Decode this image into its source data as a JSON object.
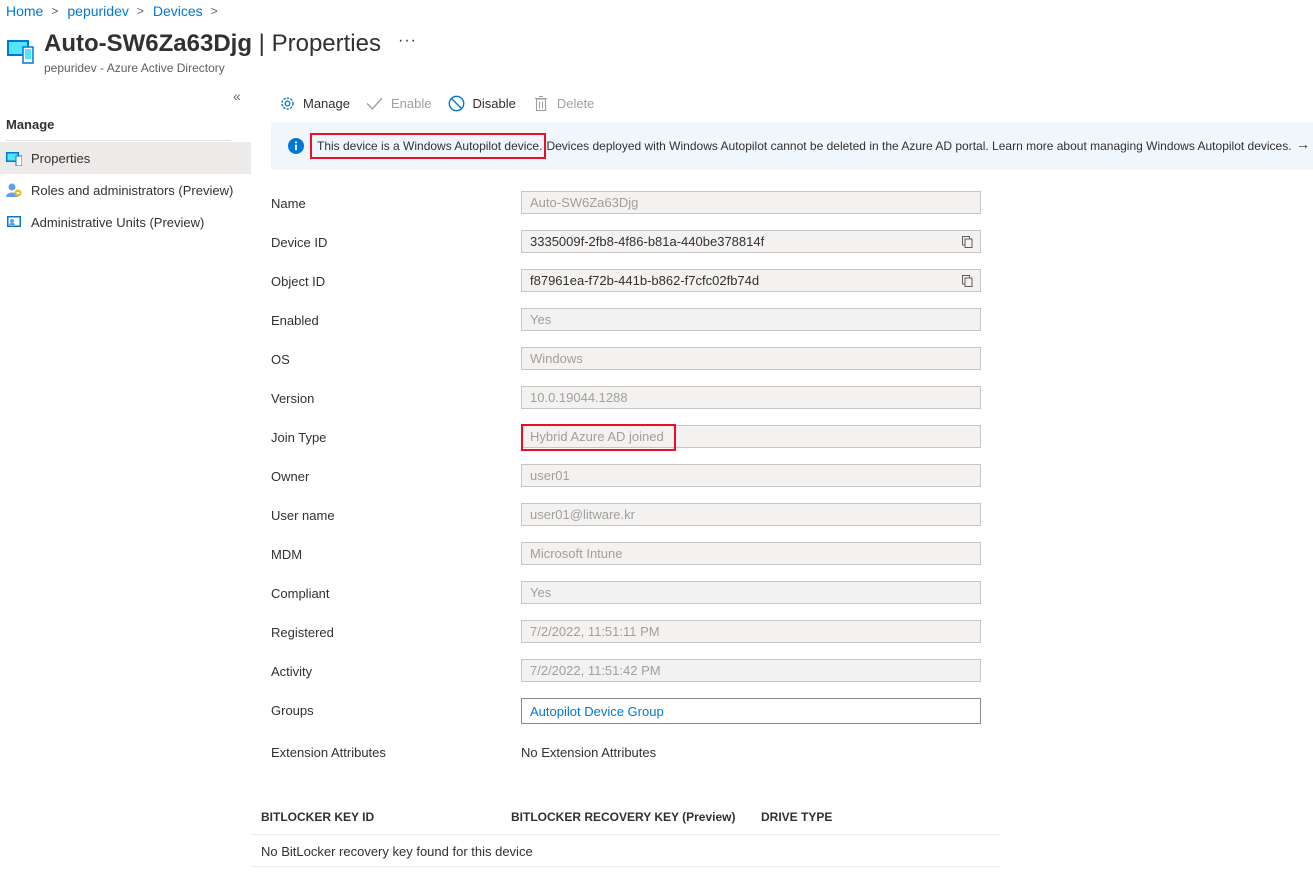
{
  "breadcrumb": [
    {
      "label": "Home"
    },
    {
      "label": "pepuridev"
    },
    {
      "label": "Devices"
    }
  ],
  "header": {
    "device_name": "Auto-SW6Za63Djg",
    "separator": " | ",
    "page_name": "Properties",
    "more": "···",
    "subtitle": "pepuridev - Azure Active Directory"
  },
  "sidebar": {
    "collapse_glyph": "«",
    "heading": "Manage",
    "items": [
      {
        "label": "Properties",
        "icon": "device-icon",
        "active": true
      },
      {
        "label": "Roles and administrators (Preview)",
        "icon": "roles-icon",
        "active": false
      },
      {
        "label": "Administrative Units (Preview)",
        "icon": "admin-units-icon",
        "active": false
      }
    ]
  },
  "toolbar": {
    "manage": "Manage",
    "enable": "Enable",
    "disable": "Disable",
    "delete": "Delete"
  },
  "banner": {
    "highlighted": "This device is a Windows Autopilot device.",
    "message": "Devices deployed with Windows Autopilot cannot be deleted in the Azure AD portal. Learn more about managing Windows Autopilot devices.",
    "arrow": "→"
  },
  "properties": {
    "name": {
      "label": "Name",
      "value": "Auto-SW6Za63Djg"
    },
    "device_id": {
      "label": "Device ID",
      "value": "3335009f-2fb8-4f86-b81a-440be378814f"
    },
    "object_id": {
      "label": "Object ID",
      "value": "f87961ea-f72b-441b-b862-f7cfc02fb74d"
    },
    "enabled": {
      "label": "Enabled",
      "value": "Yes"
    },
    "os": {
      "label": "OS",
      "value": "Windows"
    },
    "version": {
      "label": "Version",
      "value": "10.0.19044.1288"
    },
    "join_type": {
      "label": "Join Type",
      "value": "Hybrid Azure AD joined"
    },
    "owner": {
      "label": "Owner",
      "value": "user01"
    },
    "user_name": {
      "label": "User name",
      "value": "user01@litware.kr"
    },
    "mdm": {
      "label": "MDM",
      "value": "Microsoft Intune"
    },
    "compliant": {
      "label": "Compliant",
      "value": "Yes"
    },
    "registered": {
      "label": "Registered",
      "value": "7/2/2022, 11:51:11 PM"
    },
    "activity": {
      "label": "Activity",
      "value": "7/2/2022, 11:51:42 PM"
    },
    "groups": {
      "label": "Groups",
      "value": "Autopilot Device Group"
    },
    "extension_attributes": {
      "label": "Extension Attributes",
      "value": "No Extension Attributes"
    }
  },
  "bitlocker": {
    "columns": [
      "BITLOCKER KEY ID",
      "BITLOCKER RECOVERY KEY (Preview)",
      "DRIVE TYPE"
    ],
    "empty_message": "No BitLocker recovery key found for this device"
  },
  "colors": {
    "accent": "#0078d4",
    "highlight_border": "#e81123",
    "banner_bg": "#eff6fc",
    "field_bg": "#f3f2f1"
  }
}
